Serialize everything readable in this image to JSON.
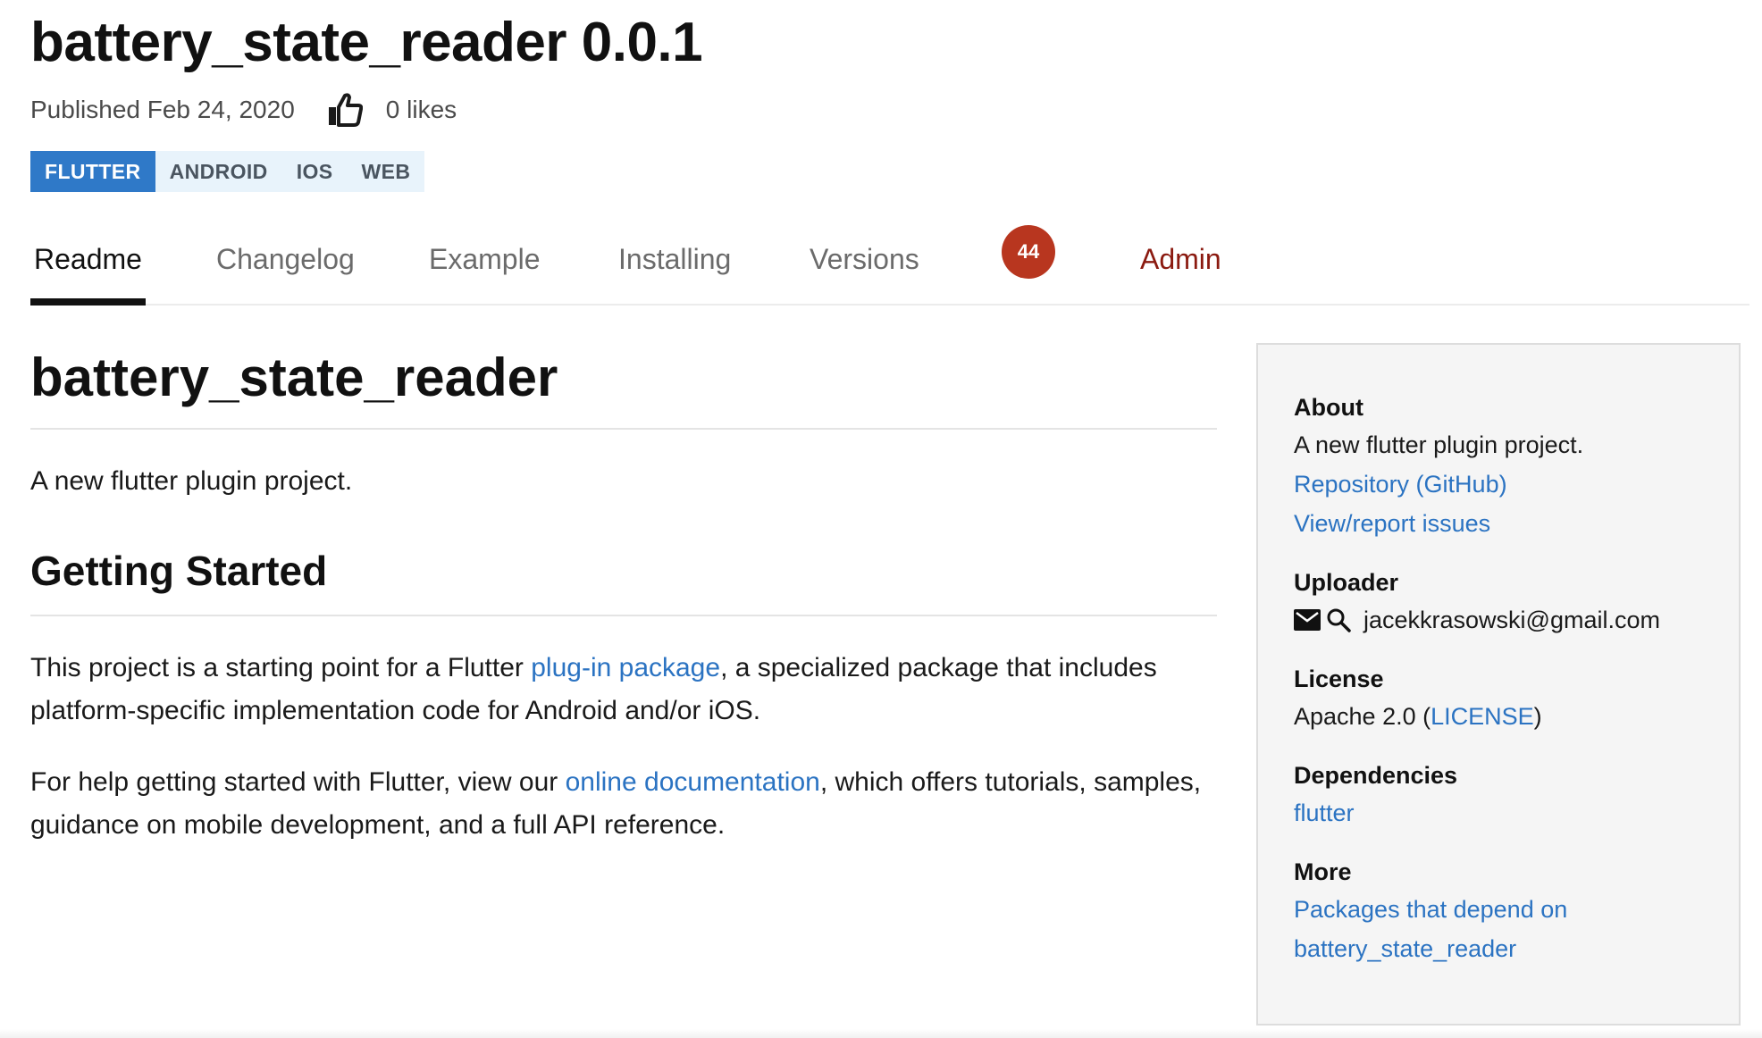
{
  "header": {
    "title": "battery_state_reader 0.0.1",
    "published": "Published Feb 24, 2020",
    "likes": "0 likes",
    "like_icon": "thumbs-up-icon",
    "tags": [
      "FLUTTER",
      "ANDROID",
      "IOS",
      "WEB"
    ]
  },
  "tabs": {
    "items": [
      "Readme",
      "Changelog",
      "Example",
      "Installing",
      "Versions"
    ],
    "active": "Readme",
    "score_badge": "44",
    "admin": "Admin"
  },
  "readme": {
    "title": "battery_state_reader",
    "intro": "A new flutter plugin project.",
    "section_title": "Getting Started",
    "para1_before": "This project is a starting point for a Flutter ",
    "para1_link": "plug-in package",
    "para1_after": ", a specialized package that includes platform-specific implementation code for Android and/or iOS.",
    "para2_before": "For help getting started with Flutter, view our ",
    "para2_link": "online documentation",
    "para2_after": ", which offers tutorials, samples, guidance on mobile development, and a full API reference."
  },
  "sidebar": {
    "about_label": "About",
    "about_text": "A new flutter plugin project.",
    "repo_link": "Repository (GitHub)",
    "issues_link": "View/report issues",
    "uploader_label": "Uploader",
    "uploader_email": "jacekkrasowski@gmail.com",
    "email_icon": "mail-icon",
    "search_icon": "search-icon",
    "license_label": "License",
    "license_text": "Apache 2.0 (",
    "license_link": "LICENSE",
    "license_close": ")",
    "dependencies_label": "Dependencies",
    "dependency": "flutter",
    "more_label": "More",
    "more_link_line1": "Packages that depend on",
    "more_link_line2": "battery_state_reader"
  },
  "colors": {
    "link": "#2b73c2",
    "tag_primary": "#2f79c8",
    "tag_bg": "#e8f3fb",
    "badge": "#b8361f",
    "admin": "#8b1a10",
    "sidebar_bg": "#f5f5f5"
  }
}
